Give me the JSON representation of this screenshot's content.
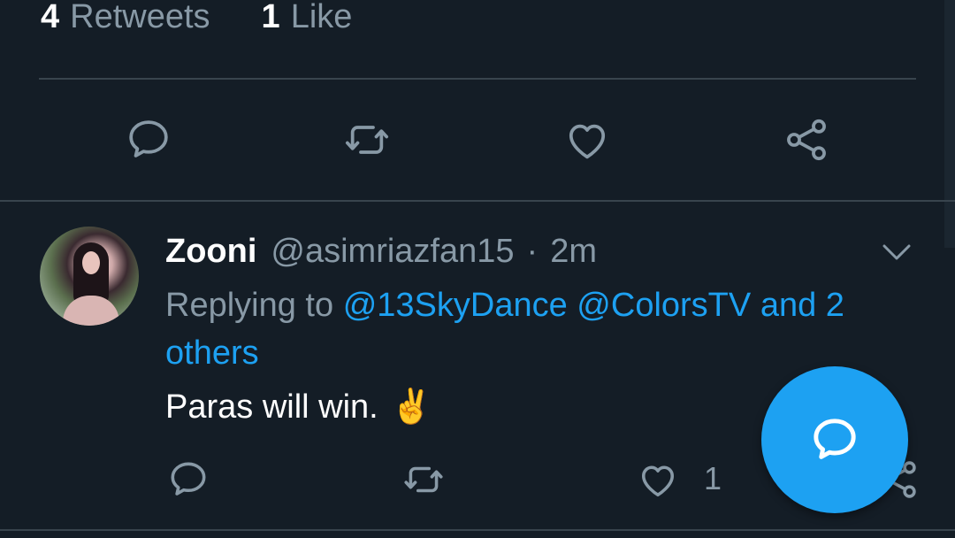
{
  "stats": {
    "retweets_count": "4",
    "retweets_label": "Retweets",
    "likes_count": "1",
    "likes_label": "Like"
  },
  "tweet_actions": [
    "reply-icon",
    "retweet-icon",
    "like-icon",
    "share-icon"
  ],
  "reply": {
    "name": "Zooni",
    "handle": "@asimriazfan15",
    "separator": "·",
    "time": "2m",
    "replying_prefix": "Replying to",
    "mention_1": "@13SkyDance",
    "mention_2": "@ColorsTV",
    "and_others": "and 2 others",
    "text": "Paras will win.",
    "emoji": "✌️",
    "like_count": "1"
  },
  "colors": {
    "background": "#141d26",
    "divider": "#38444d",
    "muted": "#8899a6",
    "accent": "#1da1f2"
  }
}
